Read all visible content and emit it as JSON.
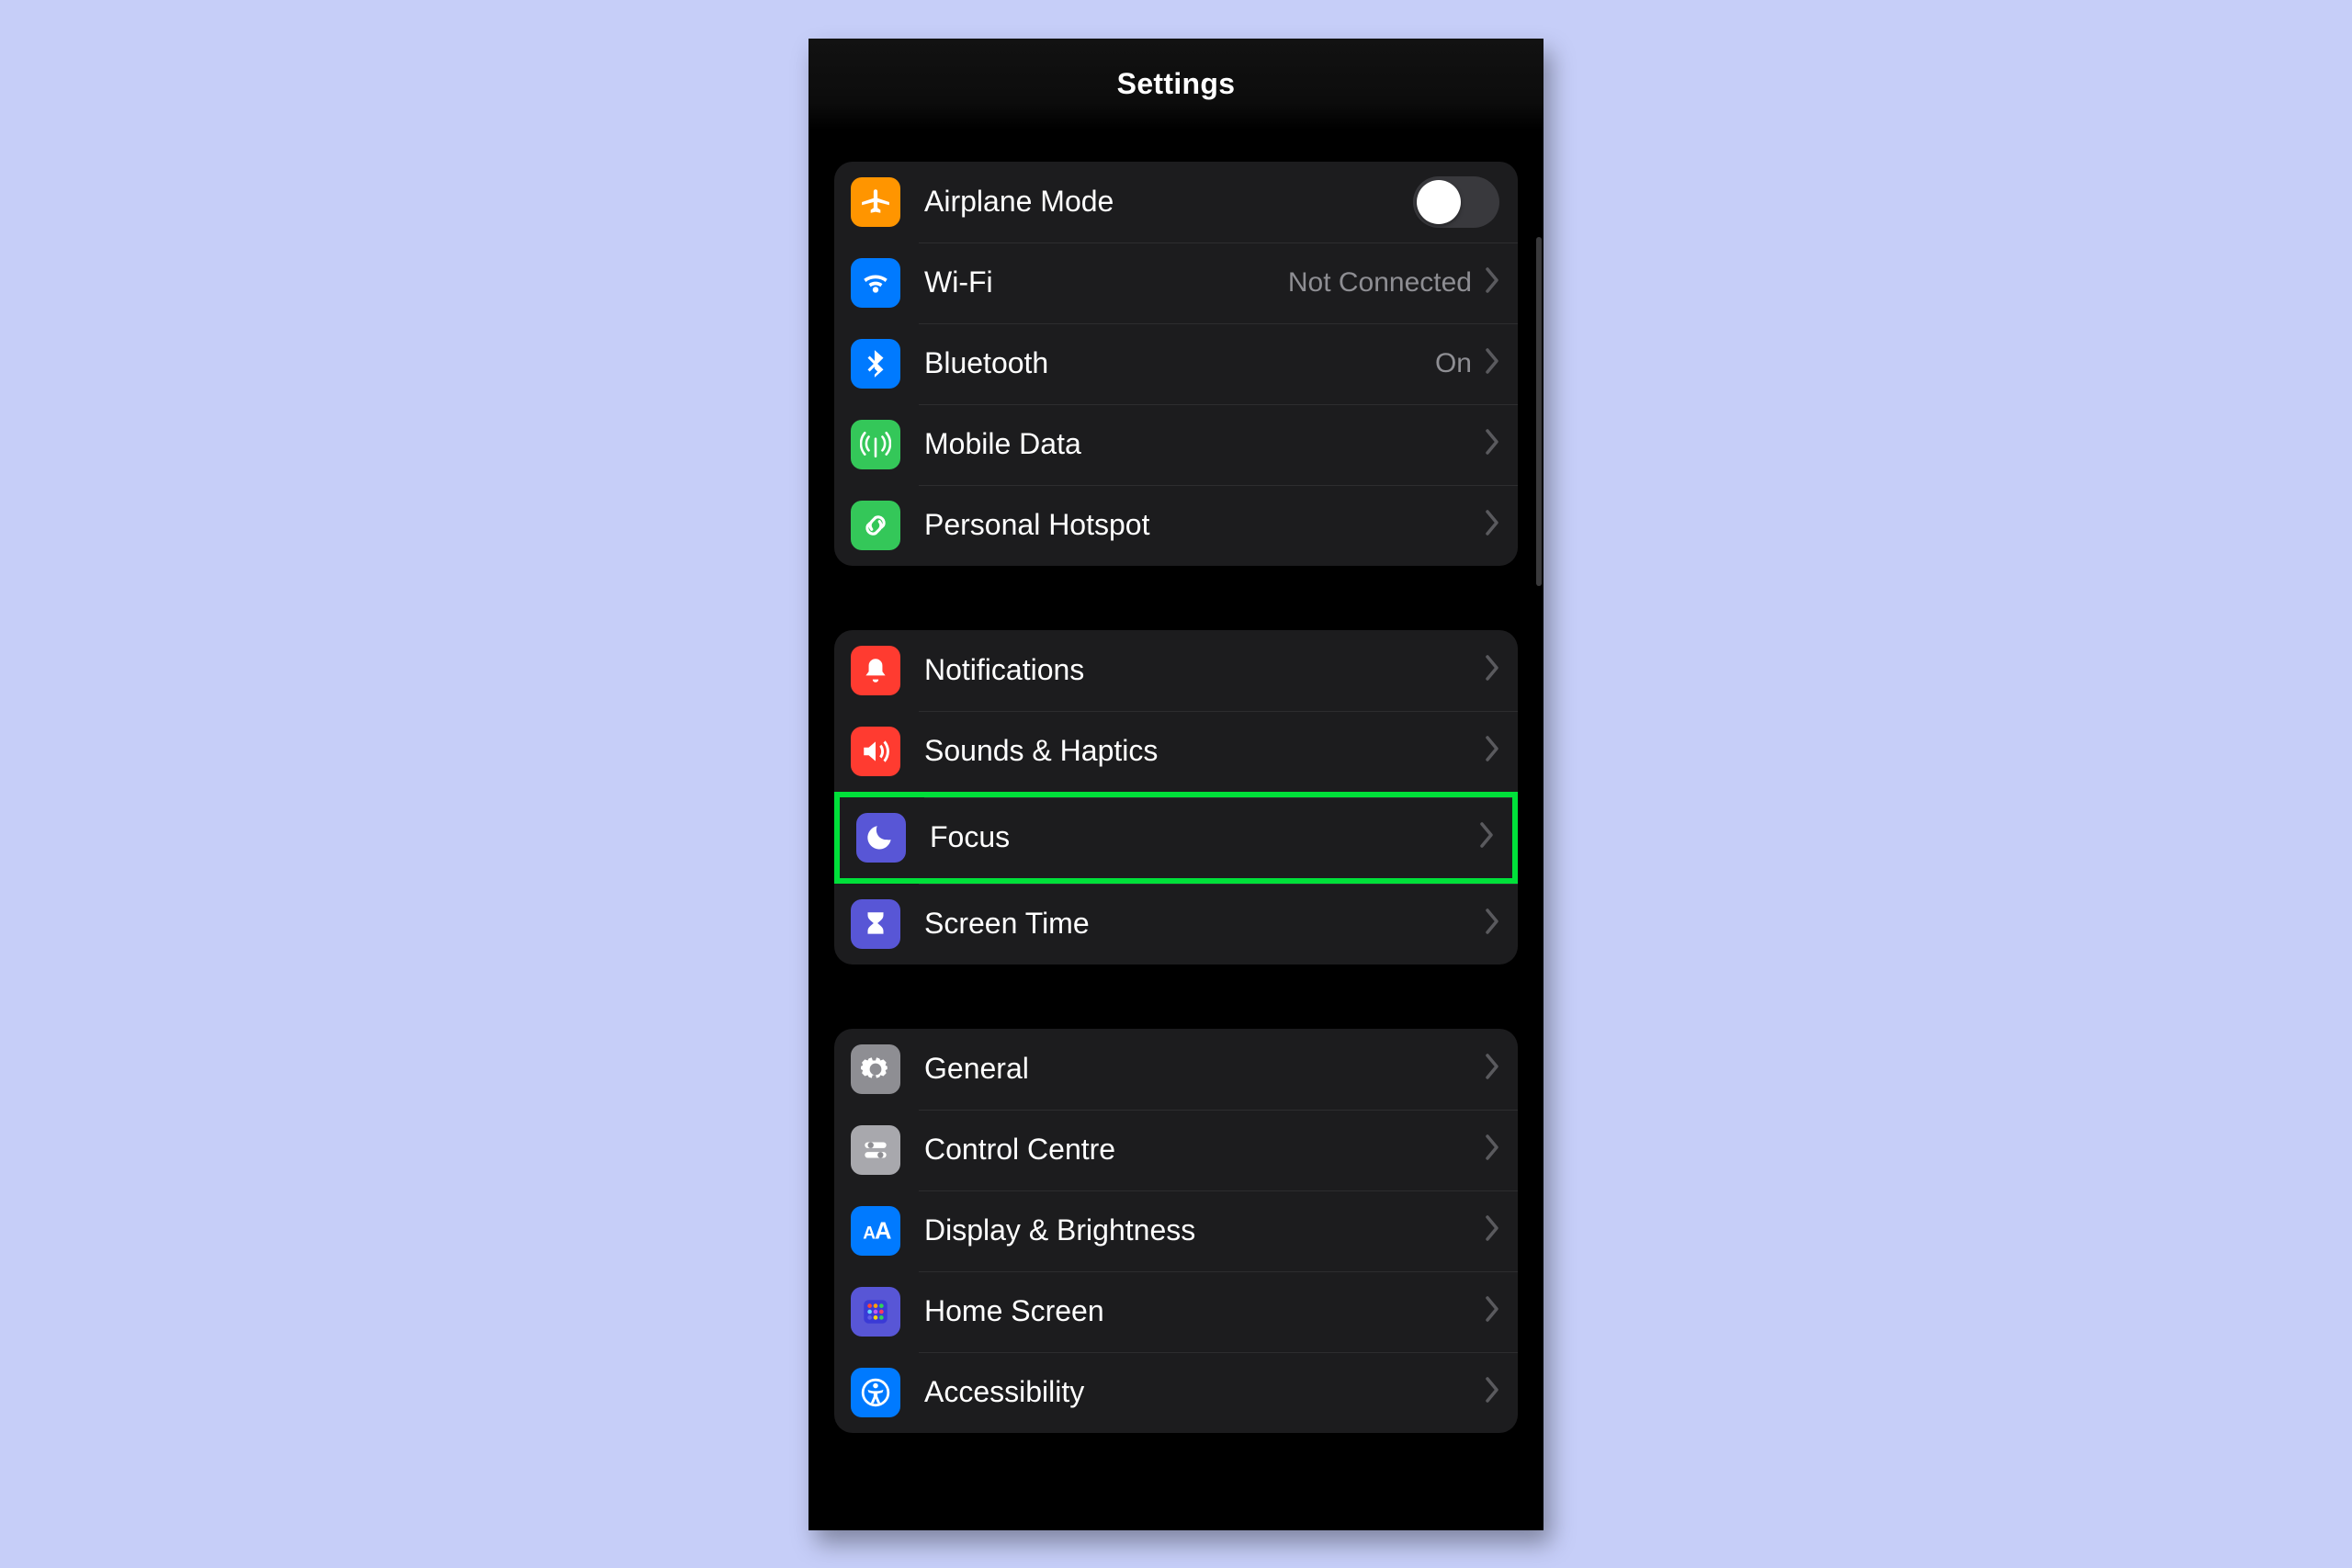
{
  "header": {
    "title": "Settings"
  },
  "groups": [
    {
      "rows": [
        {
          "id": "airplane",
          "label": "Airplane Mode",
          "icon": "airplane-icon",
          "tile": "c-orange",
          "type": "toggle",
          "toggle_on": false
        },
        {
          "id": "wifi",
          "label": "Wi-Fi",
          "icon": "wifi-icon",
          "tile": "c-blue",
          "type": "link",
          "detail": "Not Connected"
        },
        {
          "id": "bluetooth",
          "label": "Bluetooth",
          "icon": "bluetooth-icon",
          "tile": "c-blue",
          "type": "link",
          "detail": "On"
        },
        {
          "id": "mobile-data",
          "label": "Mobile Data",
          "icon": "antenna-icon",
          "tile": "c-green",
          "type": "link"
        },
        {
          "id": "hotspot",
          "label": "Personal Hotspot",
          "icon": "link-icon",
          "tile": "c-green",
          "type": "link"
        }
      ]
    },
    {
      "rows": [
        {
          "id": "notifications",
          "label": "Notifications",
          "icon": "bell-icon",
          "tile": "c-red",
          "type": "link"
        },
        {
          "id": "sounds",
          "label": "Sounds & Haptics",
          "icon": "speaker-icon",
          "tile": "c-red",
          "type": "link"
        },
        {
          "id": "focus",
          "label": "Focus",
          "icon": "moon-icon",
          "tile": "c-indigo",
          "type": "link",
          "highlighted": true
        },
        {
          "id": "screen-time",
          "label": "Screen Time",
          "icon": "hourglass-icon",
          "tile": "c-indigo",
          "type": "link"
        }
      ]
    },
    {
      "rows": [
        {
          "id": "general",
          "label": "General",
          "icon": "gear-icon",
          "tile": "c-gray",
          "type": "link"
        },
        {
          "id": "control-centre",
          "label": "Control Centre",
          "icon": "sliders-icon",
          "tile": "c-ltgray",
          "type": "link"
        },
        {
          "id": "display",
          "label": "Display & Brightness",
          "icon": "textsize-icon",
          "tile": "c-blue",
          "type": "link"
        },
        {
          "id": "home-screen",
          "label": "Home Screen",
          "icon": "grid-icon",
          "tile": "c-indigo",
          "type": "link"
        },
        {
          "id": "accessibility",
          "label": "Accessibility",
          "icon": "accessibility-icon",
          "tile": "c-blue",
          "type": "link"
        }
      ]
    }
  ]
}
